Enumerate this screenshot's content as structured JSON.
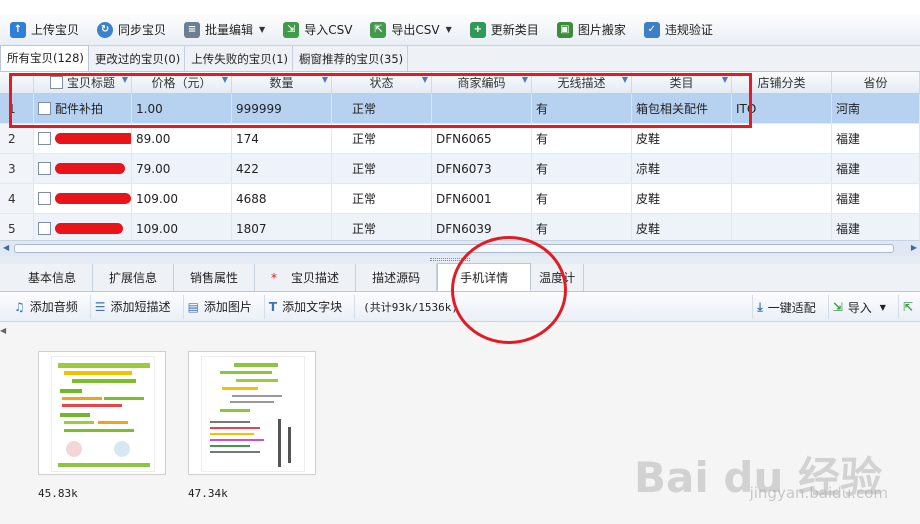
{
  "toolbar": {
    "upload": "上传宝贝",
    "sync": "同步宝贝",
    "batch_edit": "批量编辑",
    "import_csv": "导入CSV",
    "export_csv": "导出CSV",
    "update_category": "更新类目",
    "image_move": "图片搬家",
    "violation_check": "违规验证"
  },
  "list_tabs": [
    {
      "label": "所有宝贝(128)"
    },
    {
      "label": "更改过的宝贝(0)"
    },
    {
      "label": "上传失败的宝贝(1)"
    },
    {
      "label": "橱窗推荐的宝贝(35)"
    }
  ],
  "columns": [
    "宝贝标题",
    "价格（元）",
    "数量",
    "状态",
    "商家编码",
    "无线描述",
    "类目",
    "店铺分类",
    "省份"
  ],
  "rows": [
    {
      "num": "1",
      "title": "配件补拍",
      "price": "1.00",
      "qty": "999999",
      "status": "正常",
      "code": "",
      "wireless": "有",
      "category": "箱包相关配件",
      "shop_cat": "ITO",
      "province": "河南"
    },
    {
      "num": "2",
      "title": "",
      "price": "89.00",
      "qty": "174",
      "status": "正常",
      "code": "DFN6065",
      "wireless": "有",
      "category": "皮鞋",
      "shop_cat": "",
      "province": "福建"
    },
    {
      "num": "3",
      "title": "",
      "price": "79.00",
      "qty": "422",
      "status": "正常",
      "code": "DFN6073",
      "wireless": "有",
      "category": "凉鞋",
      "shop_cat": "",
      "province": "福建"
    },
    {
      "num": "4",
      "title": "",
      "price": "109.00",
      "qty": "4688",
      "status": "正常",
      "code": "DFN6001",
      "wireless": "有",
      "category": "皮鞋",
      "shop_cat": "",
      "province": "福建"
    },
    {
      "num": "5",
      "title": "",
      "price": "109.00",
      "qty": "1807",
      "status": "正常",
      "code": "DFN6039",
      "wireless": "有",
      "category": "皮鞋",
      "shop_cat": "",
      "province": "福建"
    }
  ],
  "detail_tabs": [
    {
      "label": "基本信息"
    },
    {
      "label": "扩展信息"
    },
    {
      "label": "销售属性"
    },
    {
      "label": "宝贝描述",
      "star": "*"
    },
    {
      "label": "描述源码"
    },
    {
      "label": "手机详情"
    },
    {
      "label": "温度计"
    }
  ],
  "detail_toolbar": {
    "add_audio": "添加音频",
    "add_short_desc": "添加短描述",
    "add_image": "添加图片",
    "add_text": "添加文字块",
    "size_info": "(共计93k/1536k)",
    "one_click_fit": "一键适配",
    "import": "导入"
  },
  "images": [
    {
      "size": "45.83k"
    },
    {
      "size": "47.34k"
    }
  ],
  "watermark": {
    "brand": "Bai du 经验",
    "url": "jingyan.baidu.com"
  },
  "colors": {
    "selected_row": "#b7d2f0",
    "alt_row": "#eef3fa",
    "annotation_red": "#e31b23"
  }
}
